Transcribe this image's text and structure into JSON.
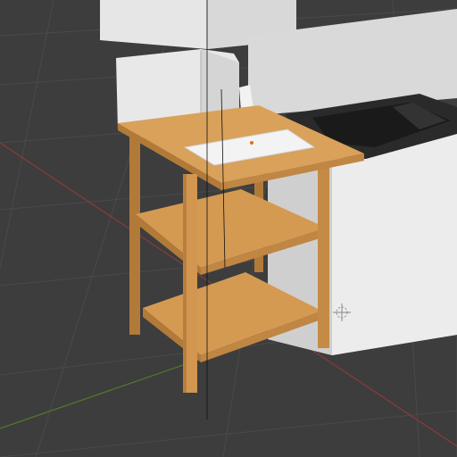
{
  "viewport": {
    "label": "",
    "background": "#3d3d3d"
  },
  "colors": {
    "grid": "#4a4a4a",
    "axis_x": "#8c3a3a",
    "axis_y": "#4f7a2a",
    "wood": "#d49a52",
    "wood_dark": "#b27a38",
    "wood_light": "#e0aa63",
    "white": "#e6e6e6",
    "white_shade": "#cfcfcf",
    "sink": "#1a1a1a"
  },
  "scene": {
    "objects": [
      "upper-cabinet",
      "microwave",
      "counter-cabinet",
      "sink",
      "wooden-shelf-cart",
      "cutting-board",
      "light-icon",
      "3d-cursor"
    ]
  }
}
